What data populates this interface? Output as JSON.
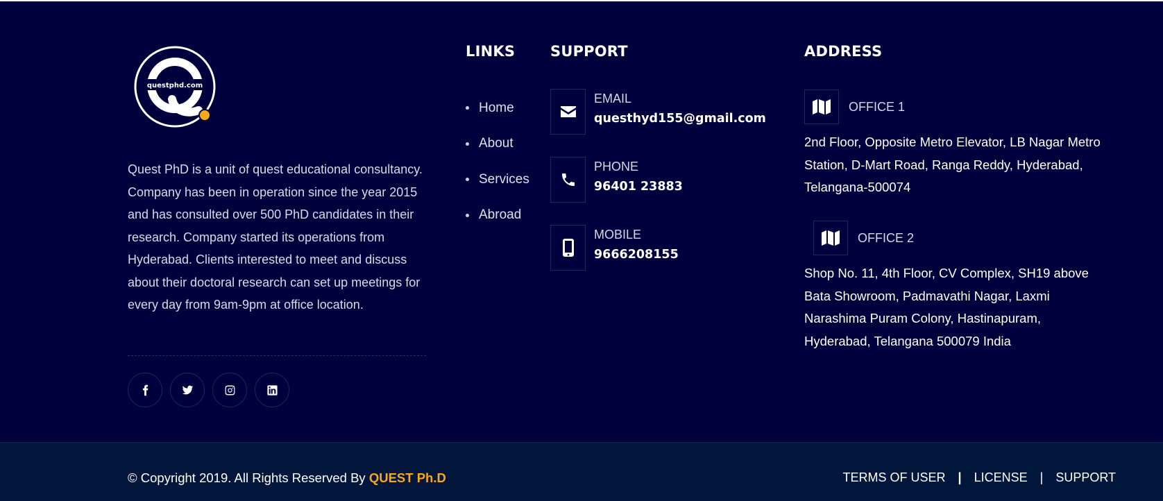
{
  "logo": {
    "text": "questphd.com",
    "ring_color": "#ffffff",
    "dot_color": "#f7a81b"
  },
  "about": {
    "text": "Quest PhD is a unit of quest educational consultancy. Company has been in operation since the year 2015 and has consulted over 500 PhD candidates in their research. Company started its operations from Hyderabad. Clients interested to meet and discuss about their doctoral research can set up meetings for every day from 9am-9pm at office location."
  },
  "social": [
    {
      "icon": "facebook-icon"
    },
    {
      "icon": "twitter-icon"
    },
    {
      "icon": "instagram-icon"
    },
    {
      "icon": "linkedin-icon"
    }
  ],
  "links": {
    "title": "LINKS",
    "items": [
      "Home",
      "About",
      "Services",
      "Abroad"
    ]
  },
  "support": {
    "title": "SUPPORT",
    "items": [
      {
        "icon": "envelope-icon",
        "label": "EMAIL",
        "value": "questhyd155@gmail.com"
      },
      {
        "icon": "phone-icon",
        "label": "PHONE",
        "value": "96401 23883"
      },
      {
        "icon": "mobile-icon",
        "label": "MOBILE",
        "value": "9666208155"
      }
    ]
  },
  "address": {
    "title": "ADDRESS",
    "offices": [
      {
        "icon": "map-icon",
        "title": "OFFICE 1",
        "address": "2nd Floor, Opposite Metro Elevator, LB Nagar Metro Station, D-Mart Road, Ranga Reddy, Hyderabad, Telangana-500074"
      },
      {
        "icon": "map-icon",
        "title": "OFFICE 2",
        "address": "Shop No. 11, 4th Floor, CV Complex, SH19 above Bata Showroom, Padmavathi Nagar, Laxmi Narashima Puram Colony, Hastinapuram, Hyderabad, Telangana 500079 India"
      }
    ]
  },
  "bottom": {
    "copyright": "© Copyright 2019. All Rights Reserved By",
    "brand": "QUEST Ph.D",
    "links": [
      "TERMS OF USER",
      "LICENSE",
      "SUPPORT"
    ],
    "separator": "|"
  },
  "colors": {
    "footer_bg": "#00003d",
    "bottom_bg": "#03173d",
    "accent": "#f7a81b"
  }
}
